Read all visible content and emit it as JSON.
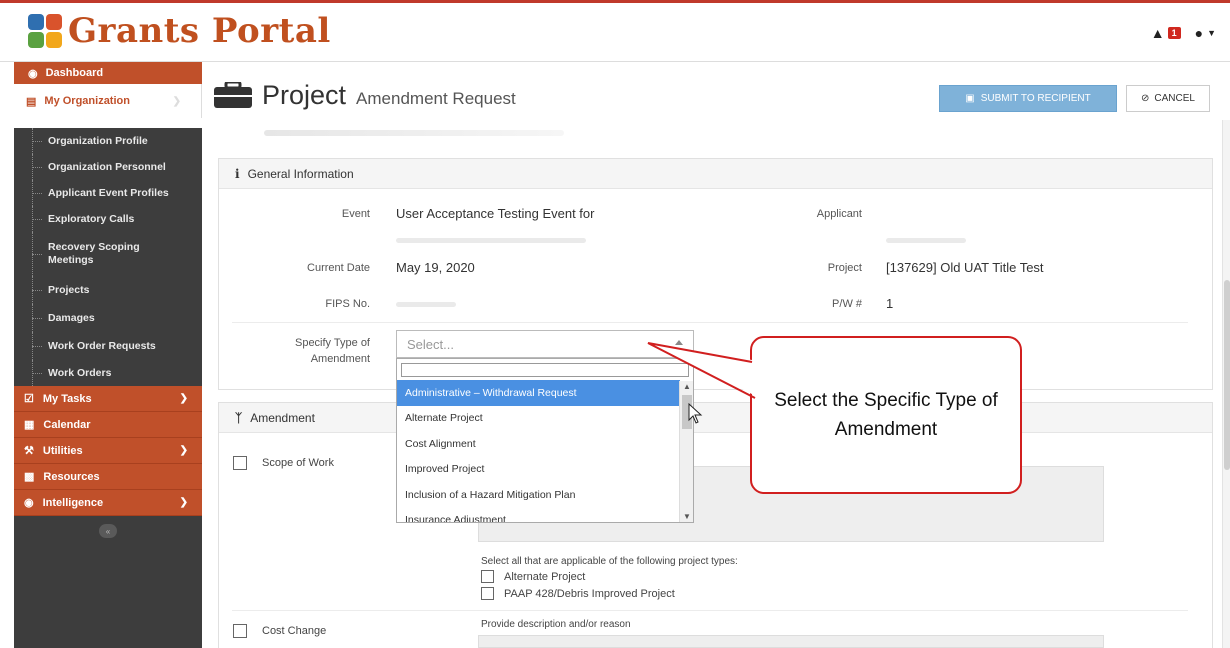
{
  "app": {
    "title": "Grants Portal",
    "notification_count": "1"
  },
  "sidebar": {
    "dashboard": "Dashboard",
    "my_organization": "My Organization",
    "sub_items": [
      "Organization Profile",
      "Organization Personnel",
      "Applicant Event Profiles",
      "Exploratory Calls",
      "Recovery Scoping Meetings",
      "Projects",
      "Damages",
      "Work Order Requests",
      "Work Orders"
    ],
    "main_items": [
      "My Tasks",
      "Calendar",
      "Utilities",
      "Resources",
      "Intelligence"
    ],
    "collapse": "«"
  },
  "page": {
    "title_main": "Project",
    "title_sub": "Amendment Request",
    "submit_label": "SUBMIT TO RECIPIENT",
    "cancel_label": "CANCEL"
  },
  "general_info": {
    "heading": "General Information",
    "event_label": "Event",
    "event_value": "User Acceptance Testing Event for",
    "applicant_label": "Applicant",
    "current_date_label": "Current Date",
    "current_date_value": "May 19, 2020",
    "project_label": "Project",
    "project_value": "[137629] Old UAT Title Test",
    "fips_label": "FIPS No.",
    "pw_label": "P/W #",
    "pw_value": "1",
    "amendment_type_label_1": "Specify Type of",
    "amendment_type_label_2": "Amendment",
    "select_placeholder": "Select..."
  },
  "dropdown": {
    "options": [
      "Administrative – Withdrawal Request",
      "Alternate Project",
      "Cost Alignment",
      "Improved Project",
      "Inclusion of a Hazard Mitigation Plan",
      "Insurance Adjustment"
    ],
    "selected_index": 0
  },
  "amendment": {
    "heading": "Amendment",
    "scope_of_work": "Scope of Work",
    "applicable_text": "Select all that are applicable of the following project types:",
    "type_alternate": "Alternate Project",
    "type_paap": "PAAP 428/Debris Improved Project",
    "cost_change": "Cost Change",
    "description_text": "Provide description and/or reason"
  },
  "callout": {
    "text": "Select the Specific Type of Amendment",
    "border_color": "#d11f1f"
  },
  "colors": {
    "brand": "#c0501f",
    "sidebar_bg": "#3d3d3d",
    "accent_red": "#c0502a",
    "submit_blue": "#7fb2d9",
    "dropdown_selected": "#4a90e2"
  }
}
